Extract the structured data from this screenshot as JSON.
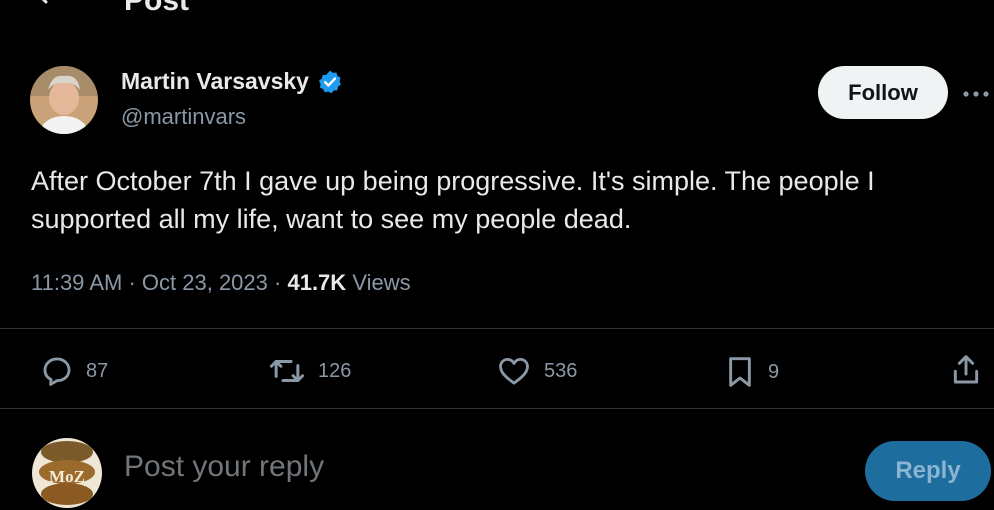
{
  "header": {
    "title": "Post",
    "back_icon": "arrow-left-icon"
  },
  "author": {
    "display_name": "Martin Varsavsky",
    "handle": "@martinvars",
    "verified_icon": "verified-badge-icon",
    "verified_color": "#1d9bf0"
  },
  "follow_label": "Follow",
  "more_icon": "more-options-icon",
  "post": {
    "text": "After October 7th I gave up being progressive. It's simple. The people I supported all my life, want to see my people dead.",
    "time": "11:39 AM",
    "separator": "·",
    "date": "Oct 23, 2023",
    "views_count": "41.7K",
    "views_label": "Views"
  },
  "actions": {
    "replies": "87",
    "reposts": "126",
    "likes": "536",
    "bookmarks": "9"
  },
  "reply_box": {
    "avatar_text": "MoZ",
    "placeholder": "Post your reply",
    "button_label": "Reply"
  },
  "colors": {
    "background": "#000000",
    "muted": "#8b98a5",
    "divider": "#2f3336",
    "reply_button": "#1d6d9e"
  }
}
